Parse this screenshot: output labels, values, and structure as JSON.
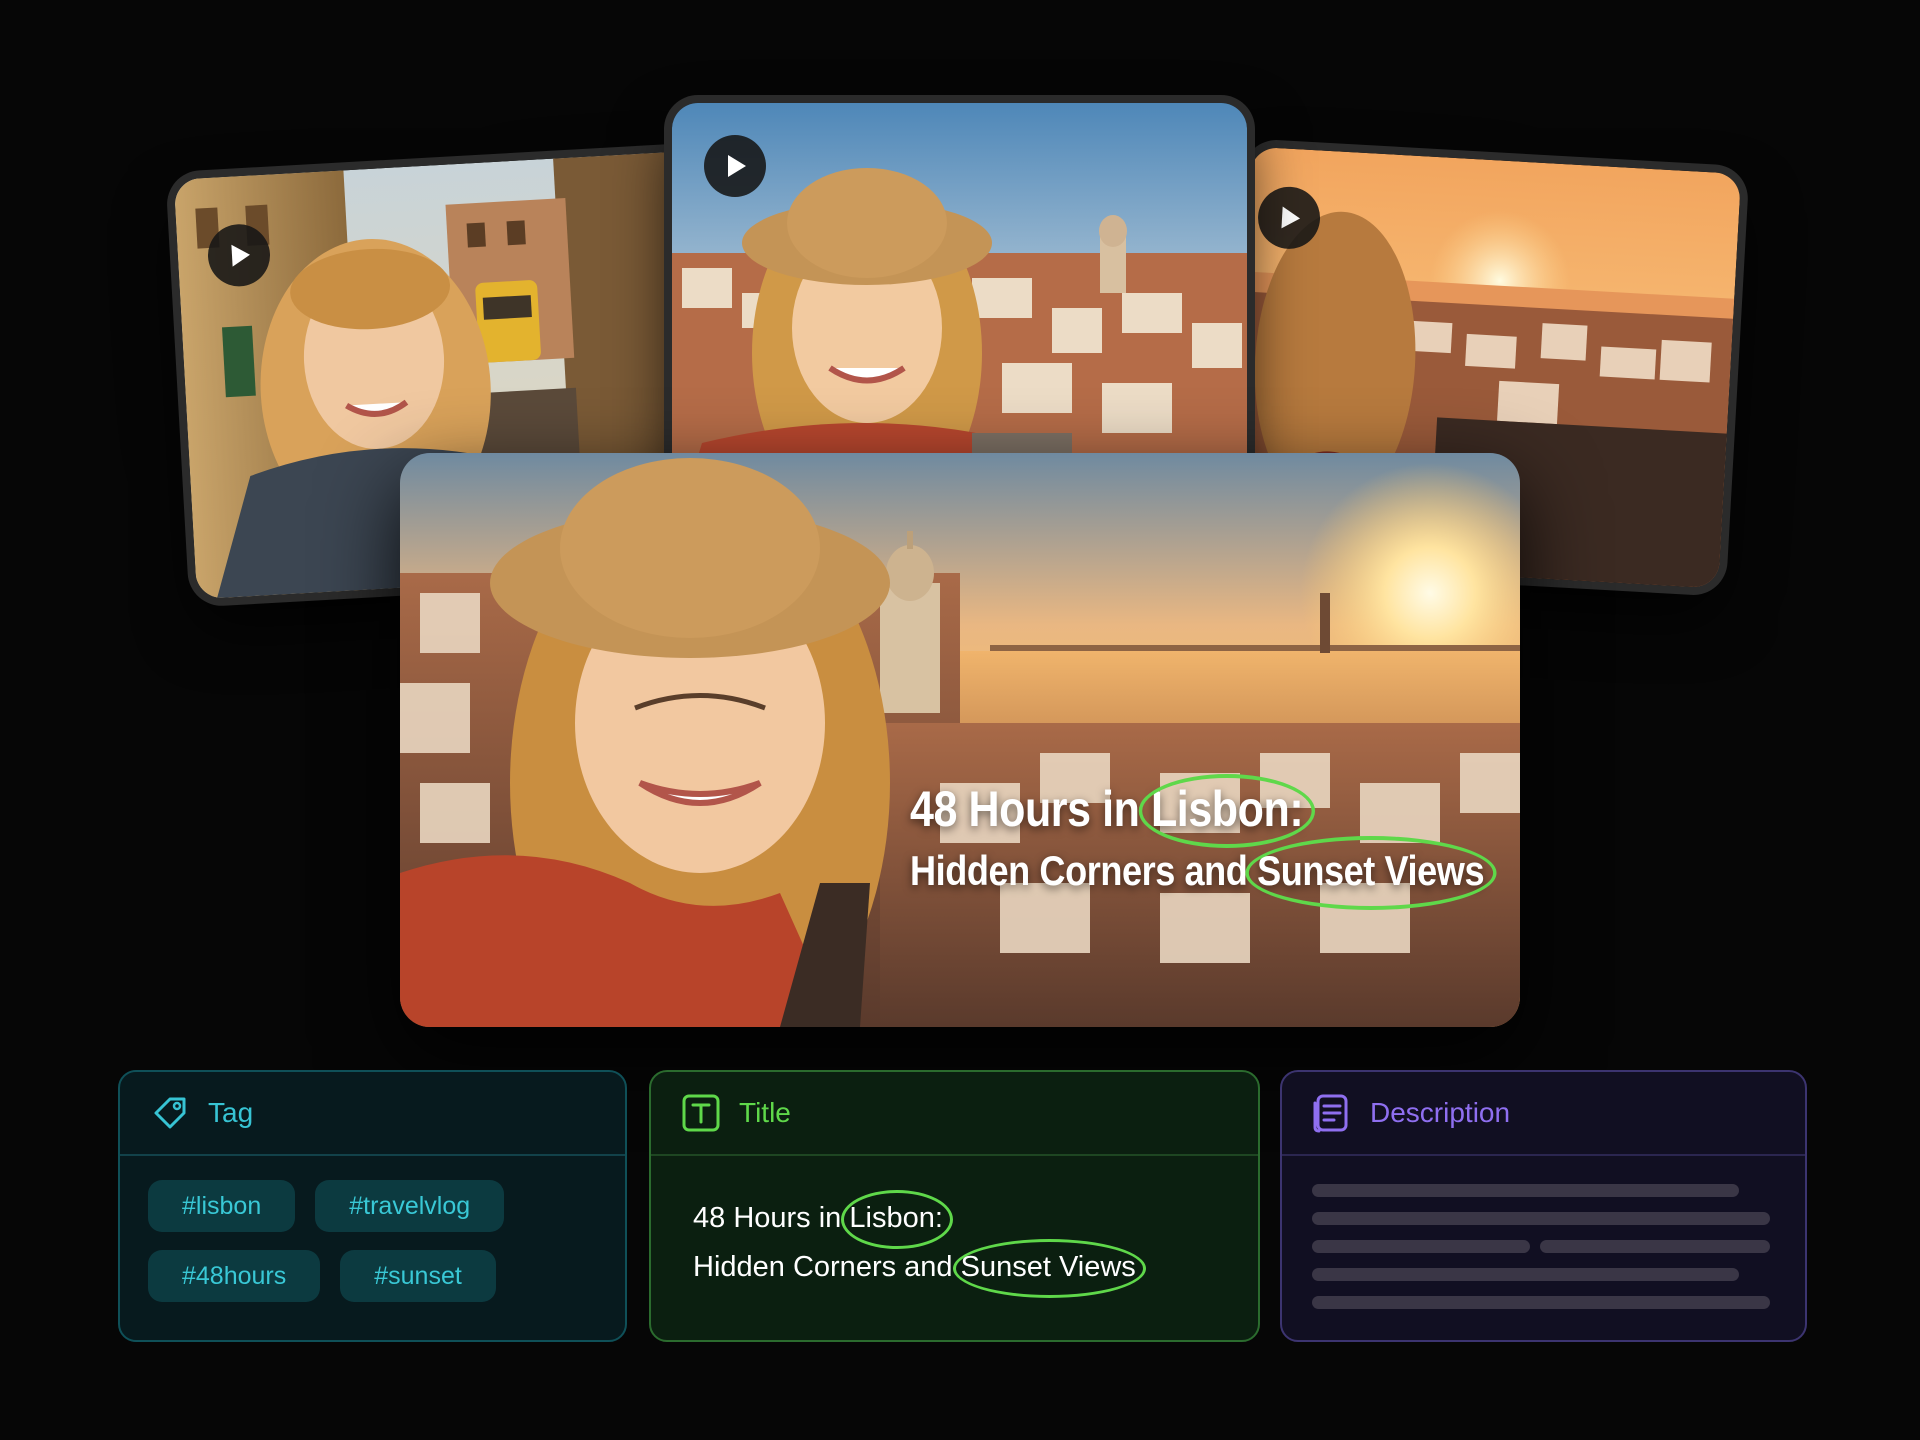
{
  "thumbnails": [
    {
      "name": "thumbnail-tram-street",
      "icon": "play-icon"
    },
    {
      "name": "thumbnail-hat-selfie",
      "icon": "play-icon"
    },
    {
      "name": "thumbnail-sunset-back",
      "icon": "play-icon"
    }
  ],
  "main_preview": {
    "title_line1_prefix": "48 Hours in",
    "title_line1_highlight": "Lisbon:",
    "title_line2_prefix": "Hidden Corners and",
    "title_line2_highlight": "Sunset Views"
  },
  "panels": {
    "tag": {
      "label": "Tag",
      "icon": "tag-icon",
      "tags": [
        "#lisbon",
        "#travelvlog",
        "#48hours",
        "#sunset"
      ]
    },
    "title": {
      "label": "Title",
      "icon": "text-t-icon",
      "line1_prefix": "48 Hours in",
      "line1_highlight": "Lisbon:",
      "line2_prefix": "Hidden Corners and",
      "line2_highlight": "Sunset Views"
    },
    "description": {
      "label": "Description",
      "icon": "document-icon"
    }
  },
  "colors": {
    "highlight": "#5fd84a",
    "tag_accent": "#37c4d4",
    "title_accent": "#5fd84a",
    "description_accent": "#8f6ff0"
  }
}
